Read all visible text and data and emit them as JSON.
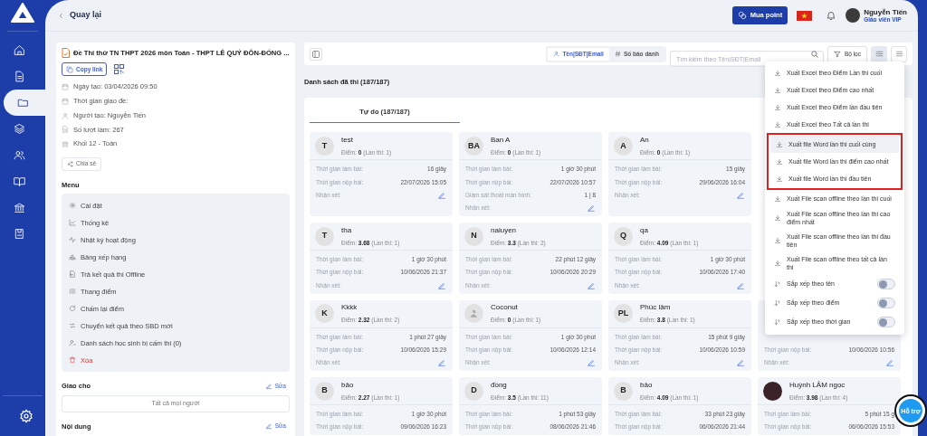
{
  "nav": [
    {
      "selected": false
    },
    {
      "selected": false
    },
    {
      "selected": true
    },
    {
      "selected": false
    },
    {
      "selected": false
    },
    {
      "selected": false
    },
    {
      "selected": false
    },
    {
      "selected": false
    }
  ],
  "back_link": "Quay lại",
  "header": {
    "buy_button": "Mua point",
    "user": {
      "name": "Nguyễn Tiến",
      "role": "Giáo viên VIP"
    }
  },
  "exam": {
    "title": "Đề Thi thử TN THPT 2026 môn Toán - THPT LÊ QUÝ ĐÔN-ĐỐNG ...",
    "copy_button": "Copy link",
    "info": [
      "Ngày tạo: 03/04/2026 09:50",
      "Thời gian giao đề:",
      "Người tạo: Nguyễn Tiến",
      "Số lượt làm: 267",
      "Khối 12 - Toán"
    ],
    "share_button": "Chia sẻ"
  },
  "menu": {
    "title": "Menu",
    "items": [
      {
        "label": "Cài đặt",
        "kind": "normal"
      },
      {
        "label": "Thống kê",
        "kind": "normal"
      },
      {
        "label": "Nhật ký hoạt động",
        "kind": "normal"
      },
      {
        "label": "Bảng xếp hạng",
        "kind": "normal"
      },
      {
        "label": "Trả kết quả thi Offline",
        "kind": "normal"
      },
      {
        "label": "Thang điểm",
        "kind": "normal"
      },
      {
        "label": "Chấm lại điểm",
        "kind": "normal"
      },
      {
        "label": "Chuyển kết quả theo SBD mới",
        "kind": "normal"
      },
      {
        "label": "Danh sách học sinh bị cấm thi (0)",
        "kind": "normal"
      },
      {
        "label": "Xóa",
        "kind": "danger"
      }
    ]
  },
  "assign": {
    "title": "Giao cho",
    "edit": "Sửa",
    "value": "Tất cả mọi người"
  },
  "content": {
    "title": "Nội dung",
    "edit": "Sửa"
  },
  "toolbar": {
    "search_modes": [
      {
        "label": "Tên|SĐT|Email",
        "selected": true
      },
      {
        "label": "Số báo danh",
        "selected": false
      }
    ],
    "search_placeholder": "Tìm kiếm theo Tên|SĐT|Email",
    "filter_button": "Bộ lọc",
    "views": [
      {
        "selected": true
      },
      {
        "selected": false
      }
    ]
  },
  "list_title": "Danh sách đã thi (187/187)",
  "tabs": [
    {
      "label": "Tự do (187/187)",
      "selected": true
    }
  ],
  "card_rows": [
    [
      {
        "kind": "initials",
        "initials": "T",
        "name": "test",
        "score": "Điểm: **0** (Lần thi: 1)",
        "fields": [
          {
            "label": "Thời gian làm bài:",
            "value": "16 giây"
          },
          {
            "label": "Thời gian nộp bài:",
            "value": "22/07/2026 15:05"
          }
        ],
        "comment_label": "Nhận xét:"
      },
      {
        "kind": "initials",
        "initials": "BA",
        "name": "Ban A",
        "score": "Điểm: **0** (Lần thi: 1)",
        "fields": [
          {
            "label": "Thời gian làm bài:",
            "value": "1 giờ 30 phút"
          },
          {
            "label": "Thời gian nộp bài:",
            "value": "22/07/2026 10:57"
          },
          {
            "label": "Giám sát thoát màn hình:",
            "value": "1 | 8"
          }
        ],
        "comment_label": "Nhận xét:"
      },
      {
        "kind": "initials",
        "initials": "A",
        "name": "An",
        "score": "Điểm: **0** (Lần thi: 1)",
        "fields": [
          {
            "label": "Thời gian làm bài:",
            "value": "15 giây"
          },
          {
            "label": "Thời gian nộp bài:",
            "value": "29/06/2026 16:04"
          }
        ],
        "comment_label": "Nhận xét:"
      }
    ],
    [
      {
        "kind": "initials",
        "initials": "T",
        "name": "tha",
        "score": "Điểm: **3.68** (Lần thi: 1)",
        "fields": [
          {
            "label": "Thời gian làm bài:",
            "value": "1 giờ 30 phút"
          },
          {
            "label": "Thời gian nộp bài:",
            "value": "10/06/2026 21:37"
          }
        ],
        "comment_label": "Nhận xét:"
      },
      {
        "kind": "initials",
        "initials": "N",
        "name": "naiuyen",
        "score": "Điểm: **3.3** (Lần thi: 2)",
        "fields": [
          {
            "label": "Thời gian làm bài:",
            "value": "22 phút 12 giây"
          },
          {
            "label": "Thời gian nộp bài:",
            "value": "10/06/2026 20:29"
          }
        ],
        "comment_label": "Nhận xét:"
      },
      {
        "kind": "initials",
        "initials": "Q",
        "name": "qa",
        "score": "Điểm: **4.09** (Lần thi: 1)",
        "fields": [
          {
            "label": "Thời gian làm bài:",
            "value": "1 giờ 30 phút"
          },
          {
            "label": "Thời gian nộp bài:",
            "value": "10/06/2026 17:40"
          }
        ],
        "comment_label": "Nhận xét:"
      }
    ],
    [
      {
        "kind": "initials",
        "initials": "K",
        "name": "Kkkk",
        "score": "Điểm: **2.32** (Lần thi: 2)",
        "fields": [
          {
            "label": "Thời gian làm bài:",
            "value": "1 phút 27 giây"
          },
          {
            "label": "Thời gian nộp bài:",
            "value": "10/06/2026 15:29"
          }
        ],
        "comment_label": "Nhận xét:"
      },
      {
        "kind": "default",
        "name": "Coconut",
        "score": "Điểm: **0** (Lần thi: 1)",
        "fields": [
          {
            "label": "Thời gian làm bài:",
            "value": "1 giờ 30 phút"
          },
          {
            "label": "Thời gian nộp bài:",
            "value": "10/06/2026 12:14"
          }
        ],
        "comment_label": "Nhận xét:"
      },
      {
        "kind": "initials",
        "initials": "PL",
        "name": "Phúc lâm",
        "score": "Điểm: **3.8** (Lần thi: 1)",
        "fields": [
          {
            "label": "Thời gian làm bài:",
            "value": "15 phút 9 giây"
          },
          {
            "label": "Thời gian nộp bài:",
            "value": "10/06/2026 10:59"
          }
        ],
        "comment_label": "Nhận xét:"
      },
      {
        "fields": [
          {
            "label": "Thời gian nộp bài:",
            "value": "10/06/2026 10:56"
          }
        ],
        "comment_label": "Nhận xét:"
      }
    ],
    [
      {
        "kind": "initials",
        "initials": "B",
        "name": "bảo",
        "score": "Điểm: **2.27** (Lần thi: 1)",
        "fields": [
          {
            "label": "Thời gian làm bài:",
            "value": "1 giờ 30 phút"
          },
          {
            "label": "Thời gian nộp bài:",
            "value": "09/06/2026 16:23"
          }
        ]
      },
      {
        "kind": "initials",
        "initials": "D",
        "name": "đồng",
        "score": "Điểm: **3.5** (Lần thi: 11)",
        "fields": [
          {
            "label": "Thời gian làm bài:",
            "value": "1 phút 53 giây"
          },
          {
            "label": "Thời gian nộp bài:",
            "value": "08/06/2026 21:46"
          }
        ]
      },
      {
        "kind": "initials",
        "initials": "B",
        "name": "bảo",
        "score": "Điểm: **4.09** (Lần thi: 1)",
        "fields": [
          {
            "label": "Thời gian làm bài:",
            "value": "33 phút 23 giây"
          },
          {
            "label": "Thời gian nộp bài:",
            "value": "06/06/2026 21:44"
          }
        ]
      },
      {
        "kind": "photo",
        "name": "Huỳnh LÂM ngọc",
        "score": "Điểm: **3.98** (Lần thi: 4)",
        "fields": [
          {
            "label": "Thời gian làm bài:",
            "value": "5 phút 15 g"
          },
          {
            "label": "Thời gian nộp bài:",
            "value": "06/06/2026 15:53"
          }
        ]
      }
    ]
  ],
  "export_menu": {
    "groups": [
      {
        "framed": false,
        "items": [
          {
            "kind": "export",
            "label": "Xuất Excel theo Điểm Lần thi cuối",
            "hovered": false
          },
          {
            "kind": "export",
            "label": "Xuất Excel theo Điểm cao nhất",
            "hovered": false
          },
          {
            "kind": "export",
            "label": "Xuất Excel theo Điểm lần đầu tiên",
            "hovered": false
          },
          {
            "kind": "export",
            "label": "Xuất Excel theo Tất cả lần thi",
            "hovered": false
          }
        ]
      },
      {
        "framed": true,
        "items": [
          {
            "kind": "export",
            "label": "Xuất file Word lần thi cuối cùng",
            "hovered": true
          },
          {
            "kind": "export",
            "label": "Xuất file Word lần thi điểm cao nhất",
            "hovered": false
          },
          {
            "kind": "export",
            "label": "Xuất file Word lần thi đầu tiên",
            "hovered": false
          }
        ]
      },
      {
        "framed": false,
        "items": [
          {
            "kind": "export",
            "label": "Xuất File scan offline theo lần thi cuối",
            "hovered": false
          },
          {
            "kind": "export",
            "label": "Xuất File scan offline theo lần thi cao điểm nhất",
            "hovered": false
          },
          {
            "kind": "export",
            "label": "Xuất File scan offline theo lần thi đầu tiên",
            "hovered": false
          },
          {
            "kind": "export",
            "label": "Xuất File scan offline theo tất cả lần thi",
            "hovered": false
          },
          {
            "kind": "sort",
            "label": "Sắp xếp theo tên",
            "on": false
          },
          {
            "kind": "sort",
            "label": "Sắp xếp theo điểm",
            "on": false
          },
          {
            "kind": "sort",
            "label": "Sắp xếp theo thời gian",
            "on": false
          }
        ]
      }
    ]
  },
  "support_button": "Hỗ trợ"
}
